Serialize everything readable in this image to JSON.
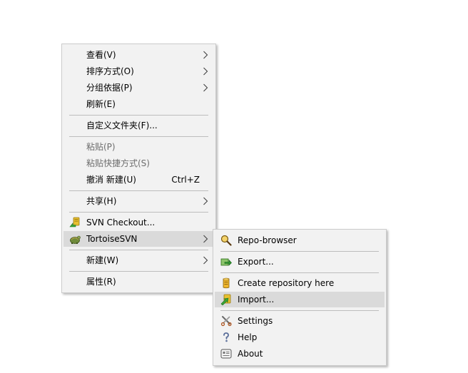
{
  "context_menu": {
    "items": [
      {
        "label": "查看(V)"
      },
      {
        "label": "排序方式(O)"
      },
      {
        "label": "分组依据(P)"
      },
      {
        "label": "刷新(E)"
      },
      {
        "label": "自定义文件夹(F)..."
      },
      {
        "label": "粘贴(P)"
      },
      {
        "label": "粘贴快捷方式(S)"
      },
      {
        "label": "撤消 新建(U)",
        "shortcut": "Ctrl+Z"
      },
      {
        "label": "共享(H)"
      },
      {
        "label": "SVN Checkout..."
      },
      {
        "label": "TortoiseSVN"
      },
      {
        "label": "新建(W)"
      },
      {
        "label": "属性(R)"
      }
    ]
  },
  "tortoisesvn_submenu": {
    "items": [
      {
        "label": "Repo-browser",
        "icon": "repo-browser-icon"
      },
      {
        "label": "Export...",
        "icon": "export-icon"
      },
      {
        "label": "Create repository here",
        "icon": "create-repository-icon"
      },
      {
        "label": "Import...",
        "icon": "import-icon"
      },
      {
        "label": "Settings",
        "icon": "settings-icon"
      },
      {
        "label": "Help",
        "icon": "help-icon"
      },
      {
        "label": "About",
        "icon": "about-icon"
      }
    ]
  },
  "colors": {
    "menu_background": "#f2f2f2",
    "hover_background": "#dadada",
    "disabled_text": "#6d6d6d",
    "separator": "#bdbdbd"
  }
}
